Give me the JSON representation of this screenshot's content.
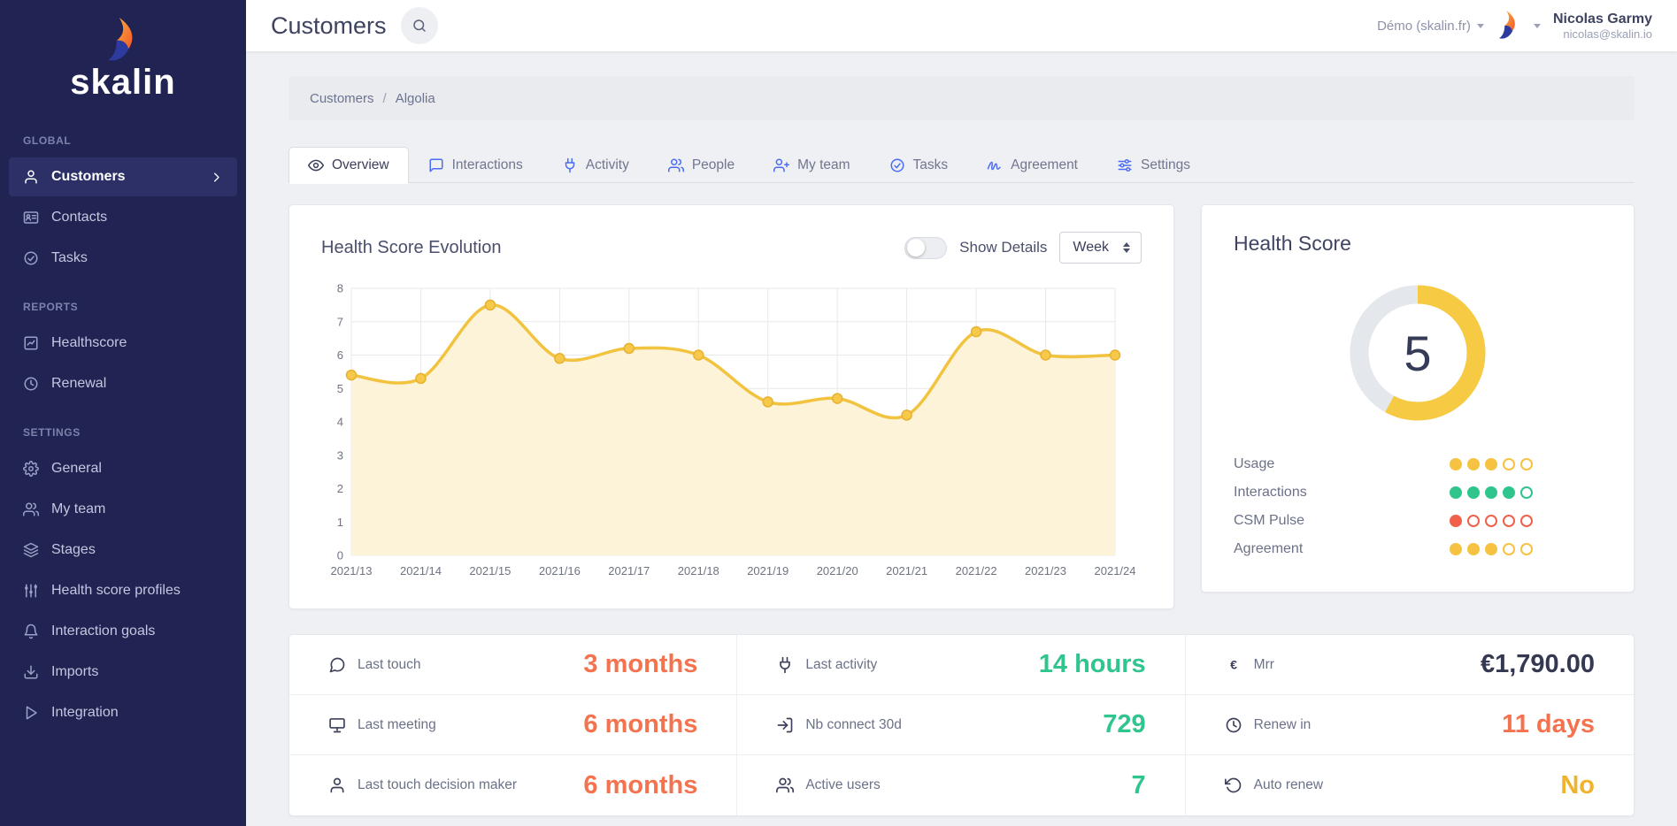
{
  "colors": {
    "sidebar_bg": "#212452",
    "accent_orange": "#f4734e",
    "accent_green": "#2fc58c",
    "accent_yellow": "#f5c242",
    "accent_red": "#f0604a",
    "accent_blue": "#4a6cf3",
    "dark": "#343851"
  },
  "sidebar": {
    "logo_text": "skalin",
    "sections": [
      {
        "label": "GLOBAL",
        "items": [
          {
            "label": "Customers",
            "icon": "user-icon",
            "active": true
          },
          {
            "label": "Contacts",
            "icon": "contacts-icon",
            "active": false
          },
          {
            "label": "Tasks",
            "icon": "tasks-icon",
            "active": false
          }
        ]
      },
      {
        "label": "REPORTS",
        "items": [
          {
            "label": "Healthscore",
            "icon": "healthscore-icon",
            "active": false
          },
          {
            "label": "Renewal",
            "icon": "clock-icon",
            "active": false
          }
        ]
      },
      {
        "label": "SETTINGS",
        "items": [
          {
            "label": "General",
            "icon": "gear-icon",
            "active": false
          },
          {
            "label": "My team",
            "icon": "team-icon",
            "active": false
          },
          {
            "label": "Stages",
            "icon": "stages-icon",
            "active": false
          },
          {
            "label": "Health score profiles",
            "icon": "profiles-icon",
            "active": false
          },
          {
            "label": "Interaction goals",
            "icon": "bell-icon",
            "active": false
          },
          {
            "label": "Imports",
            "icon": "import-icon",
            "active": false
          },
          {
            "label": "Integration",
            "icon": "integration-icon",
            "active": false
          }
        ]
      }
    ]
  },
  "topbar": {
    "title": "Customers",
    "search_icon": "search-icon",
    "workspace": "Démo (skalin.fr)",
    "user": {
      "name": "Nicolas Garmy",
      "email": "nicolas@skalin.io"
    }
  },
  "breadcrumb": {
    "parent": "Customers",
    "separator": "/",
    "current": "Algolia"
  },
  "tabs": [
    {
      "label": "Overview",
      "icon": "eye-icon",
      "active": true
    },
    {
      "label": "Interactions",
      "icon": "comment-icon",
      "active": false
    },
    {
      "label": "Activity",
      "icon": "plug-icon",
      "active": false
    },
    {
      "label": "People",
      "icon": "people-icon",
      "active": false
    },
    {
      "label": "My team",
      "icon": "user-plus-icon",
      "active": false
    },
    {
      "label": "Tasks",
      "icon": "check-icon",
      "active": false
    },
    {
      "label": "Agreement",
      "icon": "signature-icon",
      "active": false
    },
    {
      "label": "Settings",
      "icon": "sliders-icon",
      "active": false
    }
  ],
  "evolution_card": {
    "title": "Health Score Evolution",
    "toggle_label": "Show Details",
    "toggle_on": false,
    "period": "Week"
  },
  "chart_data": {
    "type": "line",
    "title": "Health Score Evolution",
    "x": [
      "2021/13",
      "2021/14",
      "2021/15",
      "2021/16",
      "2021/17",
      "2021/18",
      "2021/19",
      "2021/20",
      "2021/21",
      "2021/22",
      "2021/23",
      "2021/24"
    ],
    "series": [
      {
        "name": "Health Score",
        "values": [
          5.4,
          5.3,
          7.5,
          5.9,
          6.2,
          6.0,
          4.6,
          4.7,
          4.2,
          6.7,
          6.0,
          6.0
        ]
      }
    ],
    "ylim": [
      0,
      8
    ],
    "yticks": [
      0,
      1,
      2,
      3,
      4,
      5,
      6,
      7,
      8
    ],
    "grid": true,
    "legend": "none",
    "line_color": "#f2c33e",
    "marker_color": "#f6c94b",
    "marker_stroke": "#e8b12f",
    "fill_color": "#fcf3d8"
  },
  "health_score_card": {
    "title": "Health Score",
    "score": "5",
    "score_percent": 58,
    "ring_color": "#f7ca44",
    "track_color": "#e4e7eb",
    "metrics": [
      {
        "label": "Usage",
        "filled": 3,
        "total": 5,
        "color": "#f5c242"
      },
      {
        "label": "Interactions",
        "filled": 4,
        "total": 5,
        "color": "#2fc58c"
      },
      {
        "label": "CSM Pulse",
        "filled": 1,
        "total": 5,
        "color": "#f0604a"
      },
      {
        "label": "Agreement",
        "filled": 3,
        "total": 5,
        "color": "#f5c242"
      }
    ]
  },
  "stats": {
    "cells": [
      {
        "label": "Last touch",
        "icon": "chat-icon",
        "value": "3 months",
        "color": "#f4734e"
      },
      {
        "label": "Last activity",
        "icon": "plug-icon",
        "value": "14 hours",
        "color": "#2fc58c"
      },
      {
        "label": "Mrr",
        "icon": "euro-icon",
        "value": "€1,790.00",
        "color": "#343851"
      },
      {
        "label": "Last meeting",
        "icon": "meeting-icon",
        "value": "6 months",
        "color": "#f4734e"
      },
      {
        "label": "Nb connect 30d",
        "icon": "login-icon",
        "value": "729",
        "color": "#2fc58c"
      },
      {
        "label": "Renew in",
        "icon": "clock-icon",
        "value": "11 days",
        "color": "#f4734e"
      },
      {
        "label": "Last touch decision maker",
        "icon": "person-icon",
        "value": "6 months",
        "color": "#f4734e"
      },
      {
        "label": "Active users",
        "icon": "users-icon",
        "value": "7",
        "color": "#2fc58c"
      },
      {
        "label": "Auto renew",
        "icon": "refresh-icon",
        "value": "No",
        "color": "#f0b32e"
      }
    ]
  }
}
